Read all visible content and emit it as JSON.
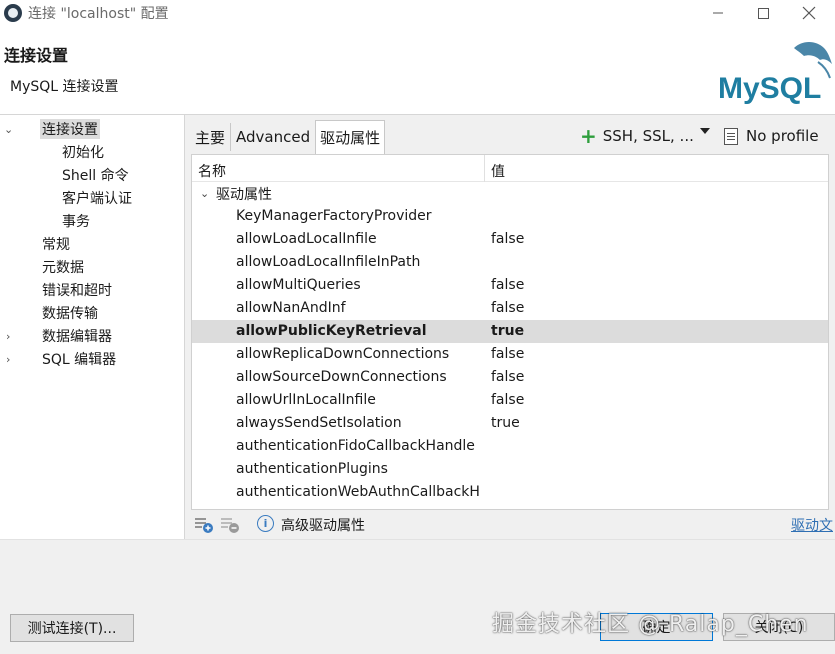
{
  "window": {
    "title": "连接 \"localhost\" 配置"
  },
  "header": {
    "title": "连接设置",
    "subtitle": "MySQL 连接设置",
    "logo_text": "MySQL"
  },
  "nav": {
    "items": [
      {
        "label": "连接设置",
        "expanded": true,
        "selected": true
      },
      {
        "label": "初始化"
      },
      {
        "label": "Shell 命令"
      },
      {
        "label": "客户端认证"
      },
      {
        "label": "事务"
      },
      {
        "label": "常规"
      },
      {
        "label": "元数据"
      },
      {
        "label": "错误和超时"
      },
      {
        "label": "数据传输"
      },
      {
        "label": "数据编辑器",
        "expandable": true
      },
      {
        "label": "SQL 编辑器",
        "expandable": true
      }
    ]
  },
  "tabs": [
    {
      "label": "主要"
    },
    {
      "label": "Advanced"
    },
    {
      "label": "驱动属性",
      "active": true
    }
  ],
  "toolbar": {
    "ssh_label": "SSH, SSL, ...",
    "profile_label": "No profile"
  },
  "grid": {
    "col_name": "名称",
    "col_value": "值",
    "group_label": "驱动属性",
    "rows": [
      {
        "name": "KeyManagerFactoryProvider",
        "value": ""
      },
      {
        "name": "allowLoadLocalInfile",
        "value": "false"
      },
      {
        "name": "allowLoadLocalInfileInPath",
        "value": ""
      },
      {
        "name": "allowMultiQueries",
        "value": "false"
      },
      {
        "name": "allowNanAndInf",
        "value": "false"
      },
      {
        "name": "allowPublicKeyRetrieval",
        "value": "true",
        "selected": true
      },
      {
        "name": "allowReplicaDownConnections",
        "value": "false"
      },
      {
        "name": "allowSourceDownConnections",
        "value": "false"
      },
      {
        "name": "allowUrlInLocalInfile",
        "value": "false"
      },
      {
        "name": "alwaysSendSetIsolation",
        "value": "true"
      },
      {
        "name": "authenticationFidoCallbackHandle",
        "value": ""
      },
      {
        "name": "authenticationPlugins",
        "value": ""
      },
      {
        "name": "authenticationWebAuthnCallbackH",
        "value": ""
      }
    ]
  },
  "footer": {
    "advanced_label": "高级驱动属性",
    "driver_link": "驱动文"
  },
  "buttons": {
    "test_connection": "测试连接(T)...",
    "ok": "确定",
    "close": "关闭(C)"
  },
  "watermark": "掘金技术社区 @ Ralap_Chen"
}
